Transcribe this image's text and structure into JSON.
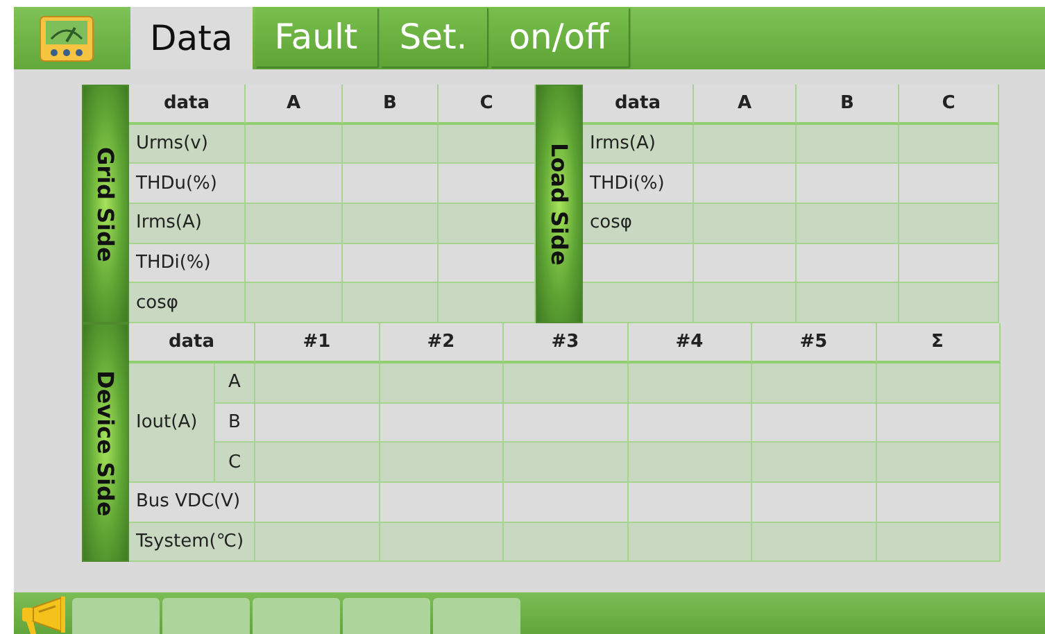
{
  "tabs": [
    {
      "label": "Data",
      "selected": true
    },
    {
      "label": "Fault",
      "selected": false
    },
    {
      "label": "Set.",
      "selected": false
    },
    {
      "label": "on/off",
      "selected": false
    }
  ],
  "grid_side": {
    "title": "Grid Side",
    "columns": [
      "data",
      "A",
      "B",
      "C"
    ],
    "rows": [
      "Urms(v)",
      "THDu(%)",
      "Irms(A)",
      "THDi(%)",
      "cosφ"
    ]
  },
  "load_side": {
    "title": "Load Side",
    "columns": [
      "data",
      "A",
      "B",
      "C"
    ],
    "rows": [
      "Irms(A)",
      "THDi(%)",
      "cosφ"
    ]
  },
  "device_side": {
    "title": "Device Side",
    "columns": [
      "data",
      "#1",
      "#2",
      "#3",
      "#4",
      "#5",
      "Σ"
    ],
    "groups": [
      {
        "label": "Iout(A)",
        "phases": [
          "A",
          "B",
          "C"
        ]
      }
    ],
    "rows": [
      "Bus VDC(V)",
      "Tsystem(℃)"
    ]
  }
}
